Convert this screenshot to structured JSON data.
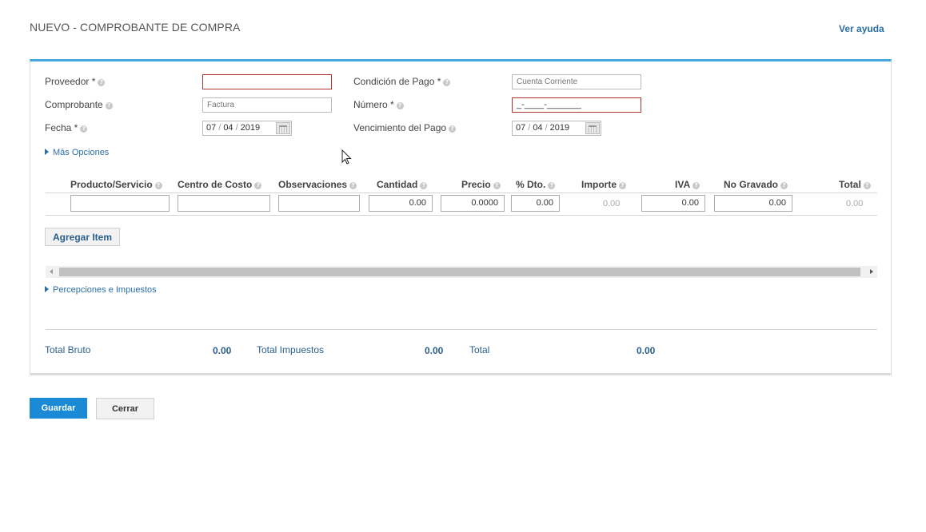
{
  "page": {
    "title": "NUEVO - COMPROBANTE DE COMPRA",
    "help_link": "Ver ayuda"
  },
  "form": {
    "proveedor": {
      "label": "Proveedor *",
      "value": ""
    },
    "comprobante": {
      "label": "Comprobante",
      "placeholder": "Factura"
    },
    "fecha": {
      "label": "Fecha *",
      "day": "07",
      "month": "04",
      "year": "2019"
    },
    "condicion_pago": {
      "label": "Condición de Pago *",
      "placeholder": "Cuenta Corriente"
    },
    "numero": {
      "label": "Número *",
      "mask": "_-____-_______"
    },
    "vencimiento": {
      "label": "Vencimiento del Pago",
      "day": "07",
      "month": "04",
      "year": "2019"
    },
    "more_options": "Más Opciones"
  },
  "items_table": {
    "headers": [
      "Producto/Servicio",
      "Centro de Costo",
      "Observaciones",
      "Cantidad",
      "Precio",
      "% Dto.",
      "Importe",
      "IVA",
      "No Gravado",
      "Total"
    ],
    "row": {
      "producto": "",
      "centro_costo": "",
      "observaciones": "",
      "cantidad": "0.00",
      "precio": "0.0000",
      "dto": "0.00",
      "importe": "0.00",
      "iva": "0.00",
      "no_gravado": "0.00",
      "total": "0.00"
    },
    "add_item_label": "Agregar Item"
  },
  "percepciones_label": "Percepciones e Impuestos",
  "totals": {
    "bruto_label": "Total Bruto",
    "bruto_value": "0.00",
    "impuestos_label": "Total Impuestos",
    "impuestos_value": "0.00",
    "total_label": "Total",
    "total_value": "0.00"
  },
  "actions": {
    "save": "Guardar",
    "close": "Cerrar"
  },
  "colors": {
    "accent": "#1a8ad6",
    "panel_top": "#48a8e0",
    "error_border": "#b03030",
    "link": "#2a6ea8"
  },
  "icons": [
    "help-icon",
    "calendar-icon",
    "expand-caret-icon",
    "mouse-pointer-icon"
  ]
}
